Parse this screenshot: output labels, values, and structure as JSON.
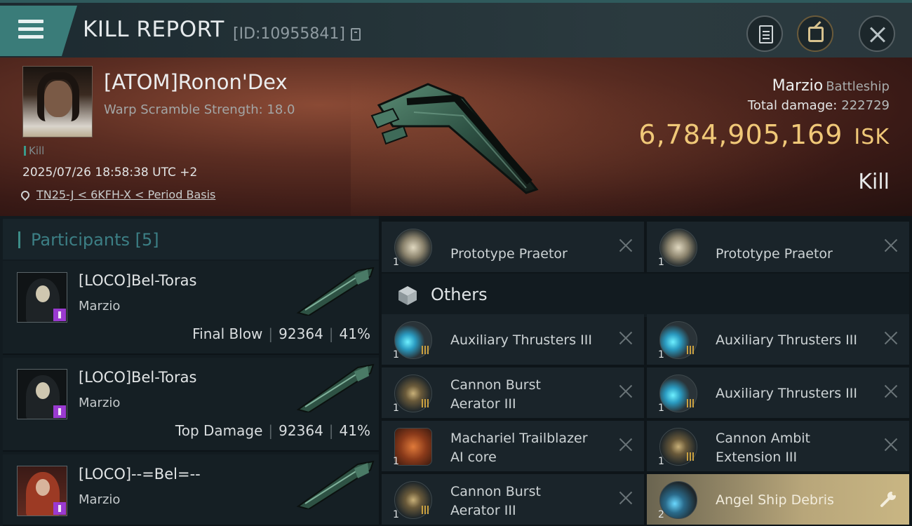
{
  "header": {
    "title": "KILL REPORT",
    "report_id": "[ID:10955841]",
    "icons": [
      "menu-icon",
      "copy-icon",
      "clipboard-icon",
      "share-icon",
      "close-icon"
    ]
  },
  "victim": {
    "name": "[ATOM]Ronon'Dex",
    "warp_scramble": "Warp Scramble Strength: 18.0",
    "tag": "Kill",
    "datetime": "2025/07/26 18:58:38 UTC +2",
    "location": "TN25-J < 6KFH-X < Period Basis",
    "ship_name": "Marzio",
    "ship_class": "Battleship",
    "total_damage_label": "Total damage:",
    "total_damage_value": "222729",
    "isk_value": "6,784,905,169",
    "isk_unit": "ISK",
    "result": "Kill"
  },
  "participants": {
    "title": "Participants",
    "count": "[5]",
    "rows": [
      {
        "name": "[LOCO]Bel-Toras",
        "ship": "Marzio",
        "role": "Final Blow",
        "damage": "92364",
        "percent": "41%"
      },
      {
        "name": "[LOCO]Bel-Toras",
        "ship": "Marzio",
        "role": "Top Damage",
        "damage": "92364",
        "percent": "41%"
      },
      {
        "name": "[LOCO]--=Bel=--",
        "ship": "Marzio",
        "role": "",
        "damage": "",
        "percent": ""
      }
    ]
  },
  "items": {
    "top_row": [
      {
        "name": "Prototype  Praetor",
        "qty": "1"
      },
      {
        "name": "Prototype  Praetor",
        "qty": "1"
      }
    ],
    "others_title": "Others",
    "others": [
      {
        "line1": "Auxiliary Thrusters III",
        "line2": "",
        "qty": "1",
        "icon": "thruster"
      },
      {
        "line1": "Auxiliary Thrusters III",
        "line2": "",
        "qty": "1",
        "icon": "thruster"
      },
      {
        "line1": "Cannon Burst",
        "line2": "Aerator III",
        "qty": "1",
        "icon": "cannon"
      },
      {
        "line1": "Auxiliary Thrusters III",
        "line2": "",
        "qty": "1",
        "icon": "thruster"
      },
      {
        "line1": "Machariel Trailblazer",
        "line2": "AI core",
        "qty": "1",
        "icon": "ai-core"
      },
      {
        "line1": "Cannon Ambit",
        "line2": "Extension III",
        "qty": "1",
        "icon": "cannon"
      },
      {
        "line1": "Cannon Burst",
        "line2": "Aerator III",
        "qty": "1",
        "icon": "cannon"
      },
      {
        "line1": "Angel Ship Debris",
        "line2": "",
        "qty": "2",
        "icon": "debris"
      }
    ]
  },
  "colors": {
    "accent": "#3d8d88",
    "isk_gold": "#f0c878",
    "highlight_gold": "#c9b683"
  }
}
